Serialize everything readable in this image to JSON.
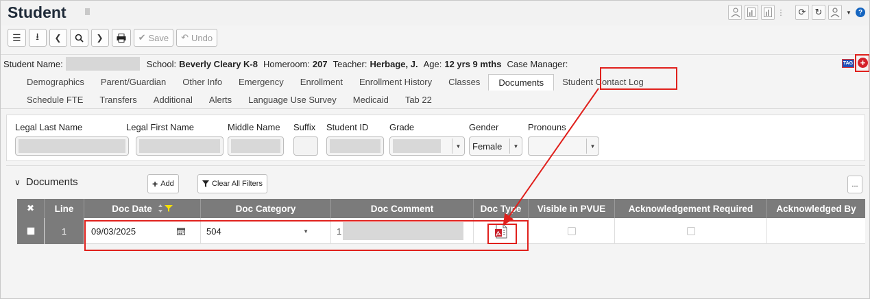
{
  "page": {
    "title": "Student"
  },
  "toolbar": {
    "menu_icon": "☰",
    "export_icon": "⭳",
    "prev_icon": "❮",
    "search_icon": "🔍",
    "next_icon": "❯",
    "print_icon": "🖶",
    "save_label": "Save",
    "undo_label": "Undo"
  },
  "info": {
    "student_name_label": "Student Name:",
    "school_label": "School:",
    "school_value": "Beverly Cleary K-8",
    "homeroom_label": "Homeroom:",
    "homeroom_value": "207",
    "teacher_label": "Teacher:",
    "teacher_value": "Herbage, J.",
    "age_label": "Age:",
    "age_value": "12 yrs 9 mths",
    "case_manager_label": "Case Manager:",
    "tag_badge": "TAG"
  },
  "tabs_row1": [
    "Demographics",
    "Parent/Guardian",
    "Other Info",
    "Emergency",
    "Enrollment",
    "Enrollment History",
    "Classes",
    "Documents",
    "Student Contact Log"
  ],
  "tabs_row2": [
    "Schedule FTE",
    "Transfers",
    "Additional",
    "Alerts",
    "Language Use Survey",
    "Medicaid",
    "Tab 22"
  ],
  "fields": {
    "legal_last_name": "Legal Last Name",
    "legal_first_name": "Legal First Name",
    "middle_name": "Middle Name",
    "suffix": "Suffix",
    "student_id": "Student ID",
    "grade": "Grade",
    "gender": "Gender",
    "gender_value": "Female",
    "pronouns": "Pronouns"
  },
  "documents": {
    "section_title": "Documents",
    "add_label": "Add",
    "clear_filters_label": "Clear All Filters",
    "more_label": "...",
    "columns": [
      "✖",
      "Line",
      "Doc Date",
      "Doc Category",
      "Doc Comment",
      "Doc Type",
      "Visible in PVUE",
      "Acknowledgement Required",
      "Acknowledged By"
    ],
    "rows": [
      {
        "line": "1",
        "doc_date": "09/03/2025",
        "doc_category": "504",
        "doc_comment_prefix": "1"
      }
    ]
  },
  "colors": {
    "header_gray": "#7b7b7b",
    "highlight_red": "#e0201c",
    "tag_blue": "#1f4fb8"
  }
}
